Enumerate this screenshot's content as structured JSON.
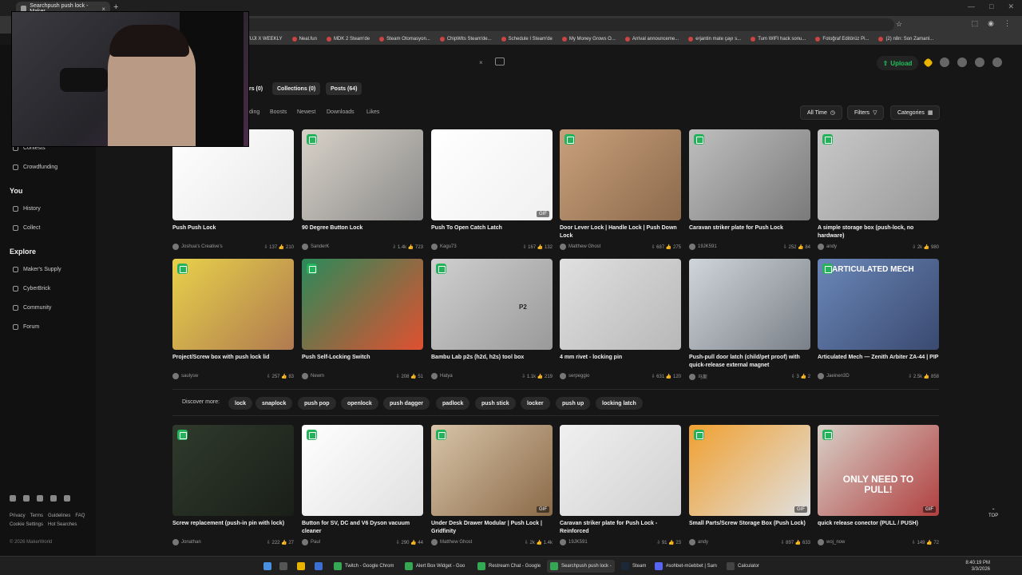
{
  "browser": {
    "tab_title": "Searchpush push lock - Maker",
    "new_tab": "+",
    "tab_close": "×",
    "window_controls": [
      "—",
      "□",
      "✕"
    ],
    "address_icons": [
      "lens-icon",
      "extensions-icon",
      "profile-icon",
      "menu-icon"
    ]
  },
  "bookmarks": [
    "FUJI X WEEKLY",
    "Neal.fun",
    "MDK 2 Steam'de",
    "Steam Otomasyon...",
    "ChipWits Steam'de...",
    "Schedule I Steam'de",
    "My Money Grows O...",
    "Arrival announceme...",
    "erjantin mate çayı s...",
    "Tum WIFI hack sonu...",
    "Fotoğraf Editörüz Pi...",
    "(2) n8n: Son Zamanl..."
  ],
  "header": {
    "upload_label": "Upload",
    "search_clear": "×"
  },
  "sidebar": {
    "items_top": [
      "Contests",
      "Crowdfunding"
    ],
    "you_heading": "You",
    "you_items": [
      "History",
      "Collect"
    ],
    "explore_heading": "Explore",
    "explore_items": [
      "Maker's Supply",
      "CyberBrick",
      "Community",
      "Forum"
    ],
    "footer_links_1": [
      "Privacy",
      "Terms",
      "Guidelines",
      "FAQ"
    ],
    "footer_links_2": [
      "Cookie Settings",
      "Hot Searches"
    ],
    "copyright": "© 2026 MakerWorld"
  },
  "result_tabs": {
    "users": "rs (0)",
    "collections": "Collections (0)",
    "posts": "Posts (64)"
  },
  "sort": {
    "trending": "ding",
    "boosts": "Boosts",
    "newest": "Newest",
    "downloads": "Downloads",
    "likes": "Likes",
    "all_time": "All Time",
    "filters": "Filters",
    "categories": "Categories"
  },
  "cards": [
    {
      "title": "Push Push Lock",
      "author": "Joshua's Creative's",
      "downloads": "137",
      "likes": "210",
      "badge": false,
      "gif": false
    },
    {
      "title": "90 Degree Button Lock",
      "author": "SanderK",
      "downloads": "1.4k",
      "likes": "723",
      "badge": true,
      "gif": false
    },
    {
      "title": "Push To Open Catch Latch",
      "author": "Kagu73",
      "downloads": "167",
      "likes": "132",
      "badge": false,
      "gif": true
    },
    {
      "title": "Door Lever Lock | Handle Lock | Push Down Lock",
      "author": "Matthew Ghost",
      "downloads": "687",
      "likes": "275",
      "badge": true,
      "gif": false
    },
    {
      "title": "Caravan striker plate for Push Lock",
      "author": "19JK591",
      "downloads": "252",
      "likes": "84",
      "badge": true,
      "gif": false
    },
    {
      "title": "A simple storage box (push-lock, no hardware)",
      "author": "andy",
      "downloads": "2k",
      "likes": "980",
      "badge": true,
      "gif": false
    },
    {
      "title": "Project/Screw box with push lock lid",
      "author": "saulysw",
      "downloads": "257",
      "likes": "83",
      "badge": true,
      "gif": false
    },
    {
      "title": "Push Self-Locking Switch",
      "author": "Newm",
      "downloads": "208",
      "likes": "51",
      "badge": true,
      "gif": false
    },
    {
      "title": "Bambu Lab p2s (h2d, h2s) tool box",
      "author": "Hatya",
      "downloads": "1.1k",
      "likes": "219",
      "badge": true,
      "gif": false
    },
    {
      "title": "4 mm rivet - locking pin",
      "author": "serpeggio",
      "downloads": "631",
      "likes": "120",
      "badge": false,
      "gif": false
    },
    {
      "title": "Push-pull door latch (child/pet proof) with quick-release external magnet",
      "author": "马斯",
      "downloads": "3",
      "likes": "2",
      "badge": false,
      "gif": false
    },
    {
      "title": "Articulated Mech — Zenith Arbiter ZA-44 | PIP",
      "author": "Jaeinen3D",
      "downloads": "2.5k",
      "likes": "858",
      "badge": true,
      "gif": false
    },
    {
      "title": "Screw replacement (push-in pin with lock)",
      "author": "Jonathan",
      "downloads": "222",
      "likes": "27",
      "badge": true,
      "gif": false
    },
    {
      "title": "Button for SV, DC and V6 Dyson vacuum cleaner",
      "author": "Paul",
      "downloads": "290",
      "likes": "44",
      "badge": true,
      "gif": false
    },
    {
      "title": "Under Desk Drawer Modular | Push Lock | Gridfinity",
      "author": "Matthew Ghost",
      "downloads": "2k",
      "likes": "1.4k",
      "badge": true,
      "gif": true
    },
    {
      "title": "Caravan striker plate for Push Lock - Reinforced",
      "author": "19JK591",
      "downloads": "91",
      "likes": "23",
      "badge": false,
      "gif": false
    },
    {
      "title": "Small Parts/Screw Storage Box (Push Lock)",
      "author": "andy",
      "downloads": "897",
      "likes": "633",
      "badge": true,
      "gif": true
    },
    {
      "title": "quick release conector (PULL / PUSH)",
      "author": "woj_now",
      "downloads": "149",
      "likes": "72",
      "badge": true,
      "gif": true
    }
  ],
  "thumb_overlays": {
    "mech_banner": "ARTICULATED MECH",
    "pull_text": "ONLY NEED TO PULL!",
    "p2_label": "P2"
  },
  "discover": {
    "label": "Discover more:",
    "tags": [
      "lock",
      "snaplock",
      "push pop",
      "openlock",
      "push dagger",
      "padlock",
      "push stick",
      "locker",
      "push up",
      "locking latch"
    ]
  },
  "top_button": "TOP",
  "taskbar": {
    "apps": [
      "Twitch - Google Chrom",
      "Alert Box Widget - Goo",
      "Restream Chat - Google",
      "Searchpush push lock -",
      "Steam",
      "#sohbet-müebbet | Sam",
      "Calculator"
    ],
    "time": "8:40:19 PM",
    "date": "3/3/2026"
  },
  "colors": {
    "accent_green": "#1fc15a",
    "background": "#161616"
  }
}
